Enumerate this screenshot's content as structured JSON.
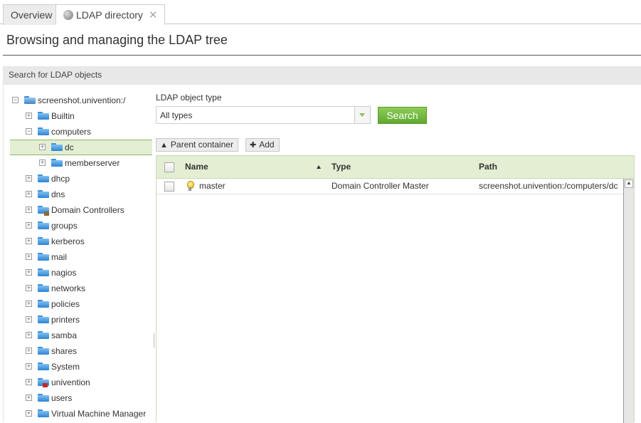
{
  "tabs": [
    {
      "label": "Overview"
    },
    {
      "label": "LDAP directory",
      "close": "✕"
    }
  ],
  "page": {
    "title": "Browsing and managing the LDAP tree"
  },
  "search_section": {
    "header": "Search for LDAP objects"
  },
  "tree": {
    "root": "screenshot.univention:/",
    "items": [
      {
        "label": "Builtin"
      },
      {
        "label": "computers"
      },
      {
        "label": "dc"
      },
      {
        "label": "memberserver"
      },
      {
        "label": "dhcp"
      },
      {
        "label": "dns"
      },
      {
        "label": "Domain Controllers"
      },
      {
        "label": "groups"
      },
      {
        "label": "kerberos"
      },
      {
        "label": "mail"
      },
      {
        "label": "nagios"
      },
      {
        "label": "networks"
      },
      {
        "label": "policies"
      },
      {
        "label": "printers"
      },
      {
        "label": "samba"
      },
      {
        "label": "shares"
      },
      {
        "label": "System"
      },
      {
        "label": "univention"
      },
      {
        "label": "users"
      },
      {
        "label": "Virtual Machine Manager"
      }
    ]
  },
  "search_form": {
    "type_label": "LDAP object type",
    "type_value": "All types",
    "search_button": "Search"
  },
  "toolbar": {
    "parent_container": "Parent container",
    "add": "Add"
  },
  "grid": {
    "columns": [
      "Name",
      "Type",
      "Path"
    ],
    "rows": [
      {
        "name": "master",
        "type": "Domain Controller Master",
        "path": "screenshot.univention:/computers/dc"
      }
    ]
  },
  "colors": {
    "accent_green": "#6cb33e",
    "selection_bg": "#e3eed3",
    "folder_blue": "#3d8fd6"
  }
}
